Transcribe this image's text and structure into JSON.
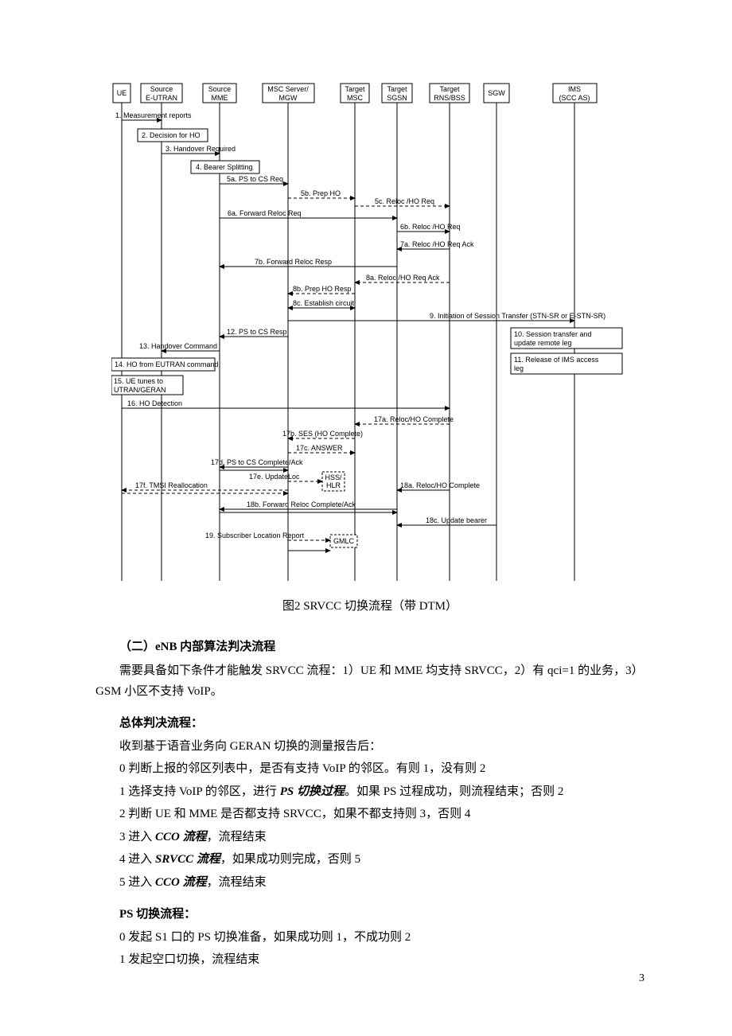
{
  "diagram": {
    "actors": {
      "ue": "UE",
      "src_eutran": "Source\nE-UTRAN",
      "src_mme": "Source\nMME",
      "msc_mgw": "MSC Server/\nMGW",
      "tgt_msc": "Target\nMSC",
      "tgt_sgsn": "Target\nSGSN",
      "tgt_rns": "Target\nRNS/BSS",
      "sgw": "SGW",
      "ims": "IMS\n(SCC AS)"
    },
    "messages": {
      "m1": "1. Measurement reports",
      "m2": "2. Decision for HO",
      "m3": "3. Handover Required",
      "m4": "4. Bearer Splitting",
      "m5a": "5a. PS to CS Req",
      "m5b": "5b. Prep HO",
      "m5c": "5c. Reloc /HO Req",
      "m6a": "6a. Forward Reloc Req",
      "m6b": "6b. Reloc /HO Req",
      "m7a": "7a. Reloc /HO Req Ack",
      "m7b": "7b. Forward Reloc Resp",
      "m8a": "8a. Reloc /HO Req Ack",
      "m8b": "8b. Prep HO Resp",
      "m8c": "8c. Establish circuit",
      "m9": "9. Initiation of Session Transfer (STN-SR or E-STN-SR)",
      "m10": "10. Session transfer and update remote leg",
      "m11": "11. Release of IMS access leg",
      "m12": "12. PS to CS Resp",
      "m13": "13. Handover Command",
      "m14": "14. HO from EUTRAN command",
      "m15": "15. UE tunes to UTRAN/GERAN",
      "m16": "16. HO Detection",
      "m17a": "17a. Reloc/HO Complete",
      "m17b": "17b. SES (HO Complete)",
      "m17c": "17c. ANSWER",
      "m17d": "17d. PS to CS Complete/Ack",
      "m17e": "17e. UpdateLoc",
      "m17f": "17f. TMSI Reallocation",
      "m18a": "18a. Reloc/HO Complete",
      "m18b": "18b. Forward Reloc Complete/Ack",
      "m18c": "18c. Update bearer",
      "m19": "19. Subscriber Location Report",
      "hss": "HSS/\nHLR",
      "gmlc": "GMLC"
    }
  },
  "caption": "图2  SRVCC 切换流程（带 DTM）",
  "section2_title": "（二）eNB 内部算法判决流程",
  "section2_para": "需要具备如下条件才能触发 SRVCC 流程：1）UE 和 MME 均支持 SRVCC，2）有 qci=1 的业务，3）GSM 小区不支持 VoIP。",
  "overall_title": "总体判决流程：",
  "overall_intro": "收到基于语音业务向 GERAN 切换的测量报告后：",
  "overall_steps": {
    "s0": "0 判断上报的邻区列表中，是否有支持 VoIP 的邻区。有则 1，没有则 2",
    "s1_pre": "1 选择支持 VoIP 的邻区，进行 ",
    "s1_em": "PS 切换过程",
    "s1_post": "。如果 PS 过程成功，则流程结束；否则 2",
    "s2": "2 判断 UE 和 MME 是否都支持 SRVCC，如果不都支持则 3，否则 4",
    "s3_pre": "3 进入 ",
    "s3_em": "CCO 流程",
    "s3_post": "，流程结束",
    "s4_pre": "4 进入 ",
    "s4_em": "SRVCC 流程",
    "s4_post": "，如果成功则完成，否则 5",
    "s5_pre": "5 进入 ",
    "s5_em": "CCO 流程",
    "s5_post": "，流程结束"
  },
  "ps_title": "PS 切换流程：",
  "ps_steps": {
    "s0": "0 发起 S1 口的 PS 切换准备，如果成功则 1，不成功则 2",
    "s1": "1 发起空口切换，流程结束"
  },
  "page_number": "3"
}
